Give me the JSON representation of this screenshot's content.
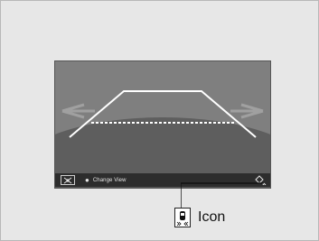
{
  "status_bar": {
    "change_view_label": "Change View"
  },
  "callout": {
    "label": "Icon"
  },
  "colors": {
    "page_bg": "#e7e7e7",
    "screen_bg": "#7f7f7f",
    "ground": "#5e5e5e",
    "bar_bg": "#2d2d2d",
    "guide_line": "#ffffff"
  }
}
